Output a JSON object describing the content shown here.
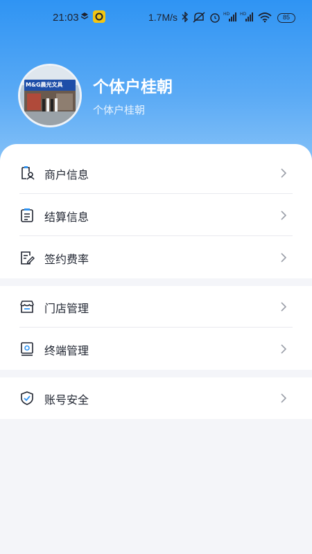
{
  "status_bar": {
    "time": "21:03",
    "network_speed": "1.7M/s",
    "battery": "85"
  },
  "profile": {
    "name": "个体户桂朝",
    "subtitle": "个体户桂朝",
    "avatar_sign_text": "M&G晨光文具"
  },
  "menu": {
    "merchant_info": "商户信息",
    "settlement_info": "结算信息",
    "contract_rate": "签约费率",
    "store_management": "门店管理",
    "terminal_management": "终端管理",
    "account_security": "账号安全"
  },
  "colors": {
    "header_top": "#2f94f3",
    "header_bottom": "#8cc5f8",
    "background": "#f4f5f9",
    "text_primary": "#1f2430"
  }
}
